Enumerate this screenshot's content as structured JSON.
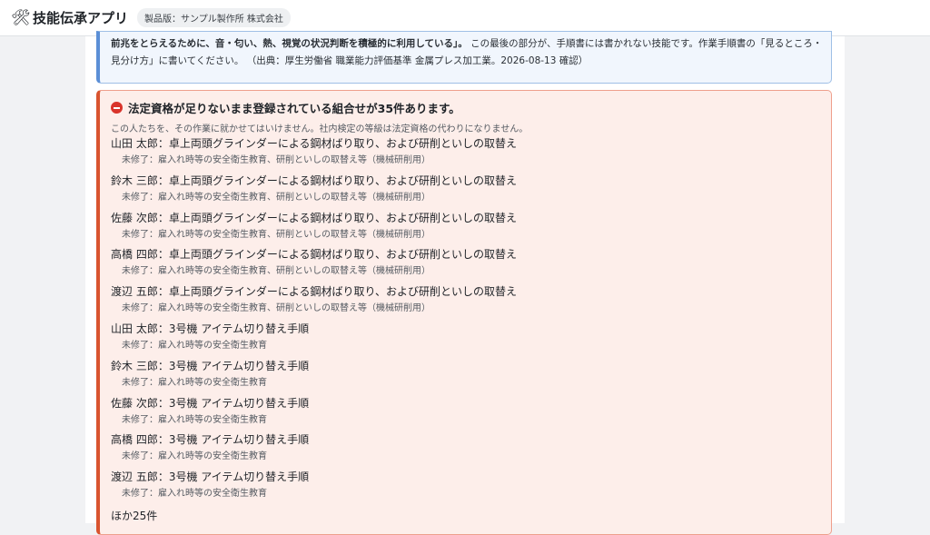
{
  "app": {
    "icon": "hammer-wrench-icon",
    "title": "技能伝承アプリ",
    "edition": "製品版：サンプル製作所 株式会社"
  },
  "info": {
    "line1": "前兆を捉えるための、音・匂い、熱、視覚の状況判断を積極的に利用している。この最後の部分が、手順書には書かれない技能です。",
    "line2_bold": "前兆をとらえるために、音・匂い、熱、視覚の状況判断を積極的に利用している」。",
    "line2_rest": " この最後の部分が、手順書には書かれない技能です。作業手順書の「見るところ・",
    "line3": "見分け方」に書いてください。 （出典：厚生労働省 職業能力評価基準 金属プレス加工業。2026-08-13 確認）"
  },
  "warning": {
    "icon": "no-entry-icon",
    "title": "法定資格が足りないまま登録されている組合せが35件あります。",
    "subtitle": "この人たちを、その作業に就かせてはいけません。社内検定の等級は法定資格の代わりになりません。",
    "entries": [
      {
        "title": "山田 太郎：卓上両頭グラインダーによる鋼材ばり取り、および研削といしの取替え",
        "detail": "未修了：雇入れ時等の安全衛生教育、研削といしの取替え等（機械研削用）"
      },
      {
        "title": "鈴木 三郎：卓上両頭グラインダーによる鋼材ばり取り、および研削といしの取替え",
        "detail": "未修了：雇入れ時等の安全衛生教育、研削といしの取替え等（機械研削用）"
      },
      {
        "title": "佐藤 次郎：卓上両頭グラインダーによる鋼材ばり取り、および研削といしの取替え",
        "detail": "未修了：雇入れ時等の安全衛生教育、研削といしの取替え等（機械研削用）"
      },
      {
        "title": "高橋 四郎：卓上両頭グラインダーによる鋼材ばり取り、および研削といしの取替え",
        "detail": "未修了：雇入れ時等の安全衛生教育、研削といしの取替え等（機械研削用）"
      },
      {
        "title": "渡辺 五郎：卓上両頭グラインダーによる鋼材ばり取り、および研削といしの取替え",
        "detail": "未修了：雇入れ時等の安全衛生教育、研削といしの取替え等（機械研削用）"
      },
      {
        "title": "山田 太郎：3号機 アイテム切り替え手順",
        "detail": "未修了：雇入れ時等の安全衛生教育"
      },
      {
        "title": "鈴木 三郎：3号機 アイテム切り替え手順",
        "detail": "未修了：雇入れ時等の安全衛生教育"
      },
      {
        "title": "佐藤 次郎：3号機 アイテム切り替え手順",
        "detail": "未修了：雇入れ時等の安全衛生教育"
      },
      {
        "title": "高橋 四郎：3号機 アイテム切り替え手順",
        "detail": "未修了：雇入れ時等の安全衛生教育"
      },
      {
        "title": "渡辺 五郎：3号機 アイテム切り替え手順",
        "detail": "未修了：雇入れ時等の安全衛生教育"
      }
    ],
    "more": "ほか25件"
  }
}
